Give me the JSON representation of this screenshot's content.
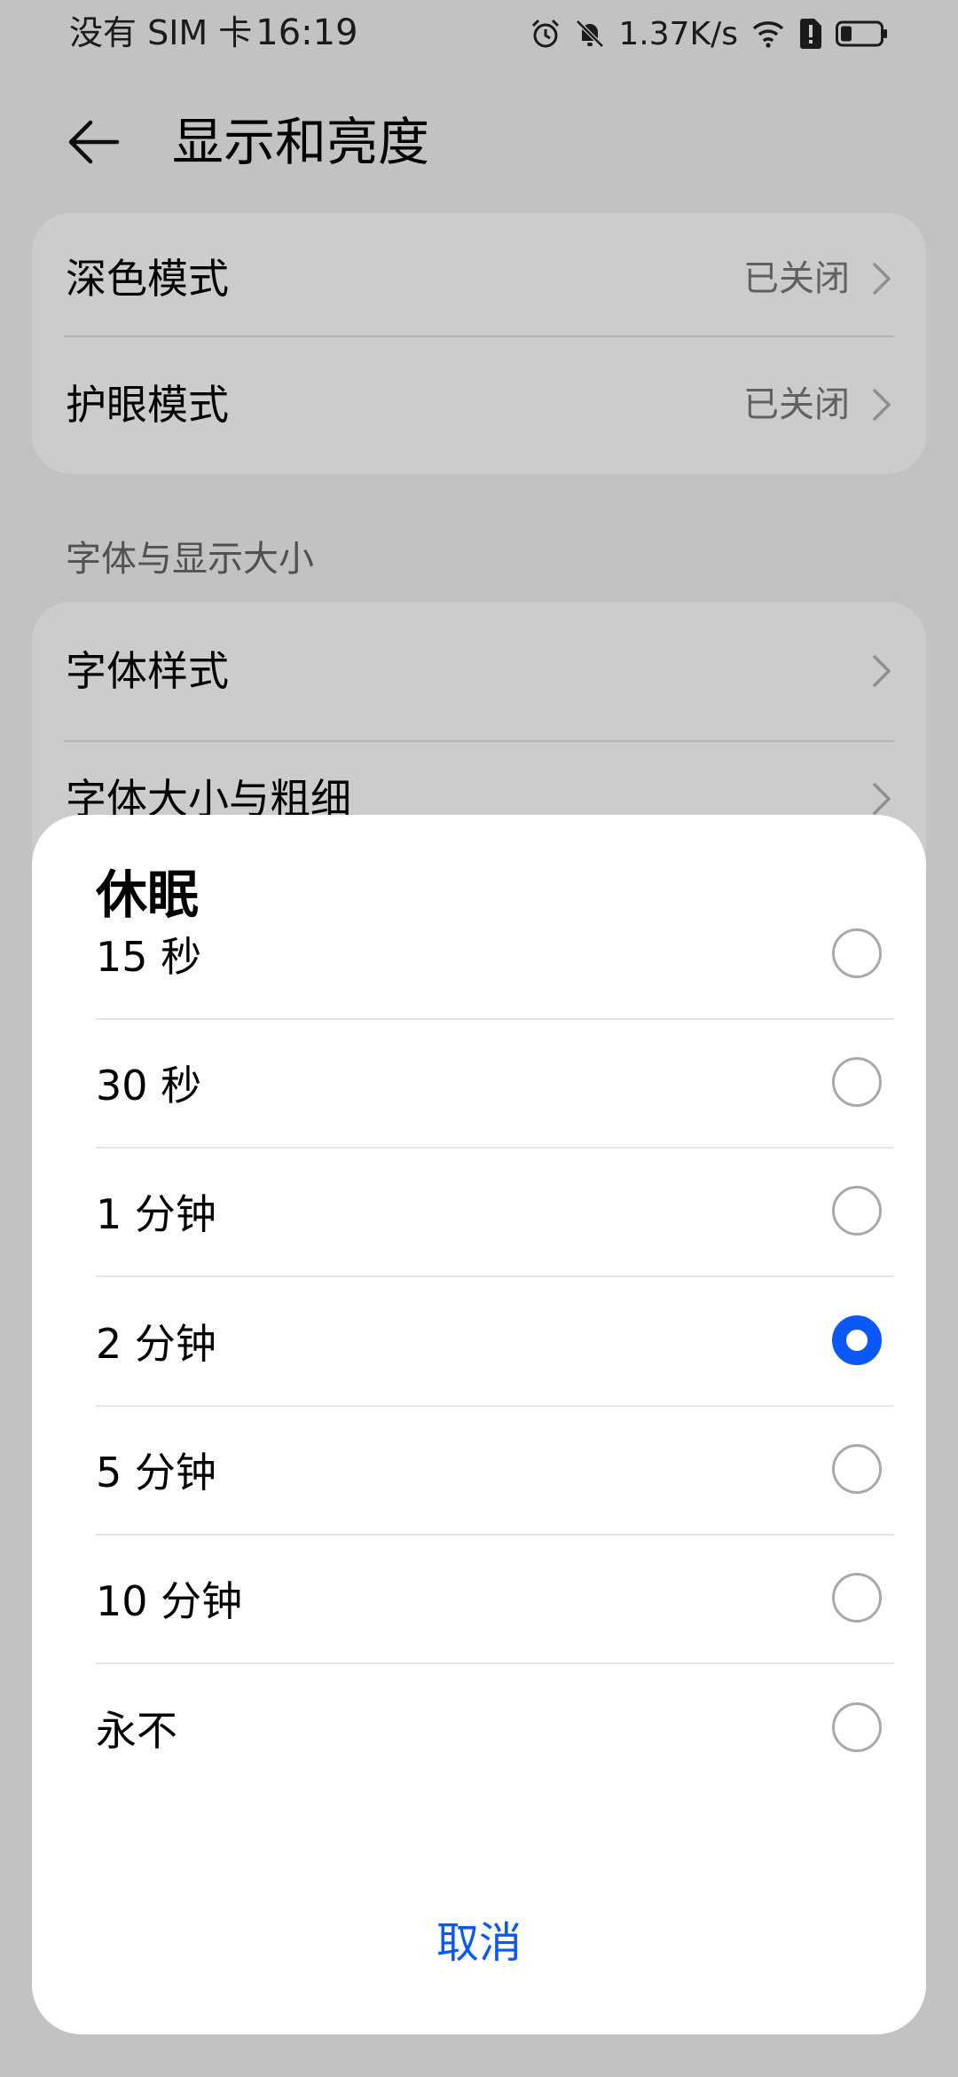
{
  "status_bar": {
    "carrier": "没有 SIM 卡",
    "time": "16:19",
    "network_speed": "1.37K/s",
    "icons": [
      "alarm-icon",
      "mute-bell-icon",
      "wifi-icon",
      "sim-alert-icon",
      "battery-icon"
    ]
  },
  "header": {
    "title": "显示和亮度",
    "back_icon": "back-arrow-icon"
  },
  "settings_group_1": {
    "items": [
      {
        "label": "深色模式",
        "value": "已关闭"
      },
      {
        "label": "护眼模式",
        "value": "已关闭"
      }
    ]
  },
  "section_font": {
    "title": "字体与显示大小",
    "items": [
      {
        "label": "字体样式"
      },
      {
        "label": "字体大小与粗细"
      }
    ]
  },
  "sleep_dialog": {
    "title": "休眠",
    "options": [
      {
        "label": "15 秒",
        "selected": false
      },
      {
        "label": "30 秒",
        "selected": false
      },
      {
        "label": "1 分钟",
        "selected": false
      },
      {
        "label": "2 分钟",
        "selected": true
      },
      {
        "label": "5 分钟",
        "selected": false
      },
      {
        "label": "10 分钟",
        "selected": false
      },
      {
        "label": "永不",
        "selected": false
      }
    ],
    "cancel_label": "取消"
  },
  "colors": {
    "accent": "#0a59f7",
    "background": "#f1f3f5",
    "card": "#ffffff",
    "secondary_text": "#7a7a7a"
  }
}
